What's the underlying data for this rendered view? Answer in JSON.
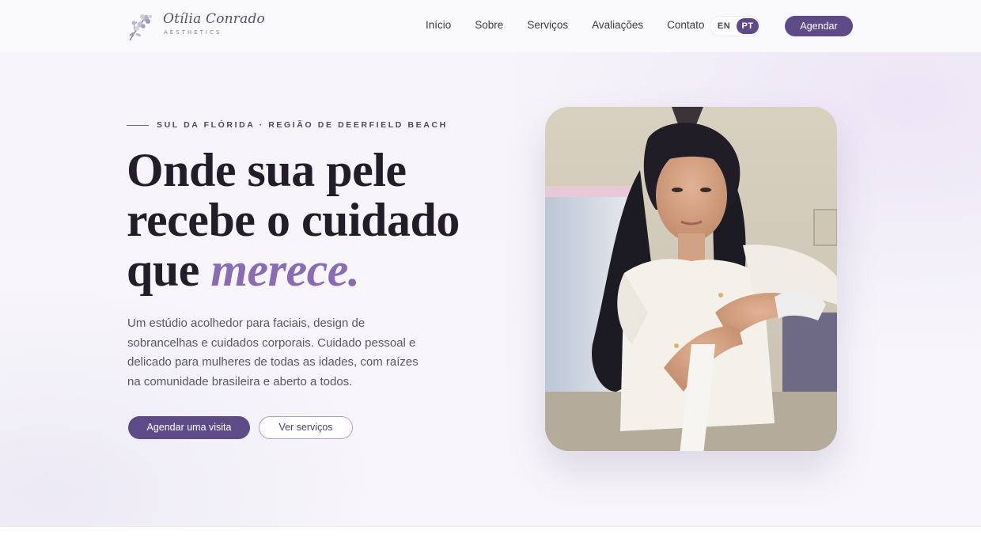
{
  "brand": {
    "name": "Otília Conrado",
    "tagline": "AESTHETICS"
  },
  "nav": {
    "items": [
      "Início",
      "Sobre",
      "Serviços",
      "Avaliações",
      "Contato"
    ]
  },
  "language": {
    "options": [
      "EN",
      "PT"
    ],
    "selected": "PT"
  },
  "header": {
    "book_label": "Agendar"
  },
  "hero": {
    "eyebrow": "SUL DA FLÓRIDA · REGIÃO DE DEERFIELD BEACH",
    "headline_line1": "Onde sua pele",
    "headline_line2": "recebe o cuidado",
    "headline_line3": "que",
    "headline_accent": "merece.",
    "lead": "Um estúdio acolhedor para faciais, design de sobrancelhas e cuidados corporais. Cuidado pessoal e delicado para mulheres de todas as idades, com raízes na comunidade brasileira e aberto a todos.",
    "primary_cta": "Agendar uma visita",
    "secondary_cta": "Ver serviços"
  },
  "colors": {
    "brand_purple": "#5d4a86",
    "accent_lilac": "#8a6bb5",
    "hero_background": "#f7f5fa"
  },
  "icons": {
    "logo": "floral-logo-icon"
  }
}
